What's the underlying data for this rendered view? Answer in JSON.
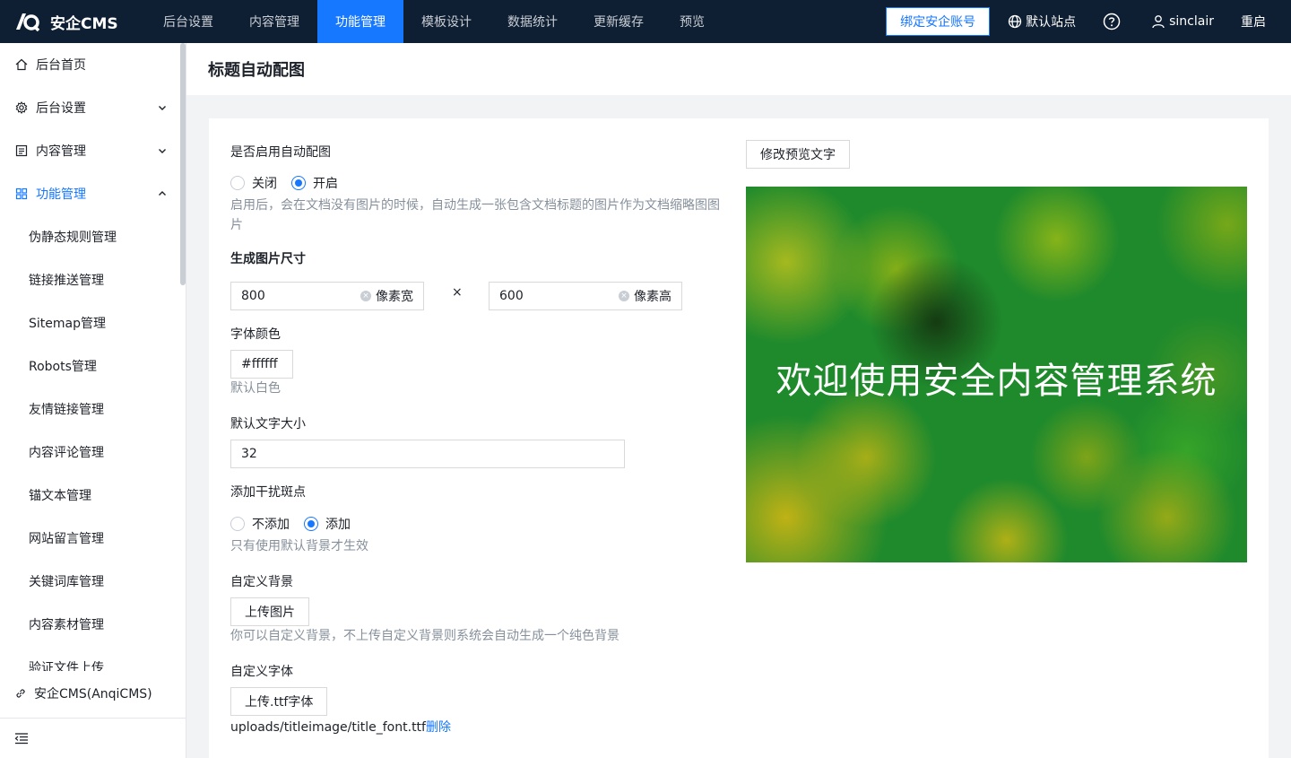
{
  "brand": {
    "name": "安企CMS"
  },
  "topnav": [
    {
      "label": "后台设置",
      "active": false
    },
    {
      "label": "内容管理",
      "active": false
    },
    {
      "label": "功能管理",
      "active": true
    },
    {
      "label": "模板设计",
      "active": false
    },
    {
      "label": "数据统计",
      "active": false
    },
    {
      "label": "更新缓存",
      "active": false
    },
    {
      "label": "预览",
      "active": false
    }
  ],
  "topright": {
    "bind_account": "绑定安企账号",
    "site": "默认站点",
    "user": "sinclair",
    "restart": "重启"
  },
  "sidebar": {
    "items": [
      {
        "label": "后台首页",
        "icon": "home-icon"
      },
      {
        "label": "后台设置",
        "icon": "gear-icon"
      },
      {
        "label": "内容管理",
        "icon": "document-icon"
      },
      {
        "label": "功能管理",
        "icon": "grid-icon"
      }
    ],
    "subitems": [
      "伪静态规则管理",
      "链接推送管理",
      "Sitemap管理",
      "Robots管理",
      "友情链接管理",
      "内容评论管理",
      "锚文本管理",
      "网站留言管理",
      "关键词库管理",
      "内容素材管理",
      "验证文件上传"
    ],
    "footer_link": "安企CMS(AnqiCMS)"
  },
  "page": {
    "title": "标题自动配图"
  },
  "form": {
    "enable_label": "是否启用自动配图",
    "enable_options": [
      "关闭",
      "开启"
    ],
    "enable_selected": "开启",
    "enable_hint_line1": "启用后，会在文档没有图片的时候，自动生成一张包含文档标题的图片作为文档缩略图图",
    "enable_hint_line2": "片",
    "size_label": "生成图片尺寸",
    "width_value": "800",
    "width_suffix": "像素宽",
    "times": "×",
    "height_value": "600",
    "height_suffix": "像素高",
    "color_label": "字体颜色",
    "color_value": "#ffffff",
    "color_hint": "默认白色",
    "fontsize_label": "默认文字大小",
    "fontsize_value": "32",
    "noise_label": "添加干扰斑点",
    "noise_options": [
      "不添加",
      "添加"
    ],
    "noise_selected": "添加",
    "noise_hint": "只有使用默认背景才生效",
    "bg_label": "自定义背景",
    "bg_button": "上传图片",
    "bg_hint": "你可以自定义背景，不上传自定义背景则系统会自动生成一个纯色背景",
    "font_label": "自定义字体",
    "font_button": "上传.ttf字体",
    "font_path": "uploads/titleimage/title_font.ttf",
    "font_delete": "删除"
  },
  "preview": {
    "button": "修改预览文字",
    "text": "欢迎使用安全内容管理系统",
    "colors": {
      "base": "#1f8a2c",
      "spots": "#b4be1e",
      "text": "#ffffff"
    }
  },
  "colors": {
    "accent": "#1677ff",
    "topbar": "#0f1f33"
  }
}
